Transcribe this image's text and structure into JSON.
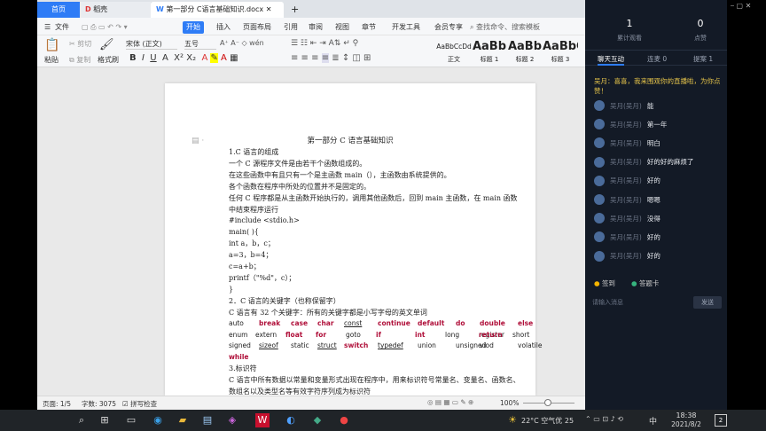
{
  "tabs": {
    "home": "首页",
    "docs": "稻壳",
    "doc_title": "第一部分 C语言基础知识.docx",
    "add": "+"
  },
  "ribbon": {
    "file": "文件",
    "tabs": [
      "开始",
      "插入",
      "页面布局",
      "引用",
      "审阅",
      "视图",
      "章节",
      "开发工具",
      "会员专享"
    ],
    "search": "查找命令、搜索模板"
  },
  "toolbar": {
    "cut": "剪切",
    "copy": "复制",
    "paste": "粘贴",
    "format_painter": "格式刷",
    "font_name": "宋体 (正文)",
    "font_size": "五号",
    "styles": [
      {
        "preview": "AaBbCcDd",
        "name": "正文"
      },
      {
        "preview": "AaBb",
        "name": "标题 1"
      },
      {
        "preview": "AaBb",
        "name": "标题 2"
      },
      {
        "preview": "AaBbC",
        "name": "标题 3"
      }
    ]
  },
  "document": {
    "title": "第一部分 C 语言基础知识",
    "lines": [
      "1.C 语言的组成",
      "一个 C 源程序文件是由若干个函数组成的。",
      "在这些函数中有且只有一个是主函数 main（），主函数由系统提供的。",
      "各个函数在程序中所处的位置并不是固定的。",
      "任何 C 程序都是从主函数开始执行的，调用其他函数后，回到 main 主函数，在 main 函数",
      "中结束程序运行",
      "#include <stdio.h>",
      "main( ){",
      "int   a，b，c；",
      "a=3，b=4；",
      "c=a+b；",
      "printf（\"%d\"，c）；",
      "}",
      "2．C 语言的关键字（也称保留字）",
      "C 语言有 32 个关键字：所有的关键字都是小写字母的英文单词"
    ],
    "keywords": [
      [
        "auto",
        "break",
        "case",
        "char",
        "const",
        "continue",
        "default",
        "do",
        "double",
        "else"
      ],
      [
        "enum",
        "extern",
        "float",
        "for",
        "goto",
        "if",
        "int",
        "long",
        "register",
        "return",
        "short"
      ],
      [
        "signed",
        "sizeof",
        "static",
        "struct",
        "switch",
        "typedef",
        "union",
        "unsigned",
        "viod",
        "volatile"
      ],
      [
        "while"
      ]
    ],
    "tail": [
      "3.标识符",
      "C 语言中所有数据以常量和变量形式出现在程序中，用来标识符号常量名、变量名、函数名、",
      "数组名以及类型名等有效字符序列成为标识符"
    ]
  },
  "status": {
    "page": "页面: 1/5",
    "words": "字数: 3075",
    "spell": "拼写检查",
    "zoom": "100%"
  },
  "chat": {
    "viewers": "1",
    "viewers_label": "累计观看",
    "likes": "0",
    "likes_label": "点赞",
    "tabs": [
      "聊天互动",
      "连麦 0",
      "提案 1"
    ],
    "notice": "吴月：喜喜，我来围观你的直播啦，为你点赞！",
    "messages": [
      {
        "user": "吴月(吴月)",
        "text": "能"
      },
      {
        "user": "吴月(吴月)",
        "text": "第一年"
      },
      {
        "user": "吴月(吴月)",
        "text": "明白"
      },
      {
        "user": "吴月(吴月)",
        "text": "好的好的麻烦了"
      },
      {
        "user": "吴月(吴月)",
        "text": "好的"
      },
      {
        "user": "吴月(吴月)",
        "text": "嗯嗯"
      },
      {
        "user": "吴月(吴月)",
        "text": "没得"
      },
      {
        "user": "吴月(吴月)",
        "text": "好的"
      },
      {
        "user": "吴月(吴月)",
        "text": "好的"
      }
    ],
    "signin": "签到",
    "answer": "答题卡",
    "input_placeholder": "请输入消息",
    "send": "发送"
  },
  "taskbar": {
    "weather": "22°C 空气优 25",
    "lang": "中",
    "time": "18:38",
    "date": "2021/8/2",
    "badge": "2"
  },
  "colors": {
    "accent": "#2e7cf6",
    "keyword": "#b0103a",
    "chat_bg": "#131a26"
  }
}
